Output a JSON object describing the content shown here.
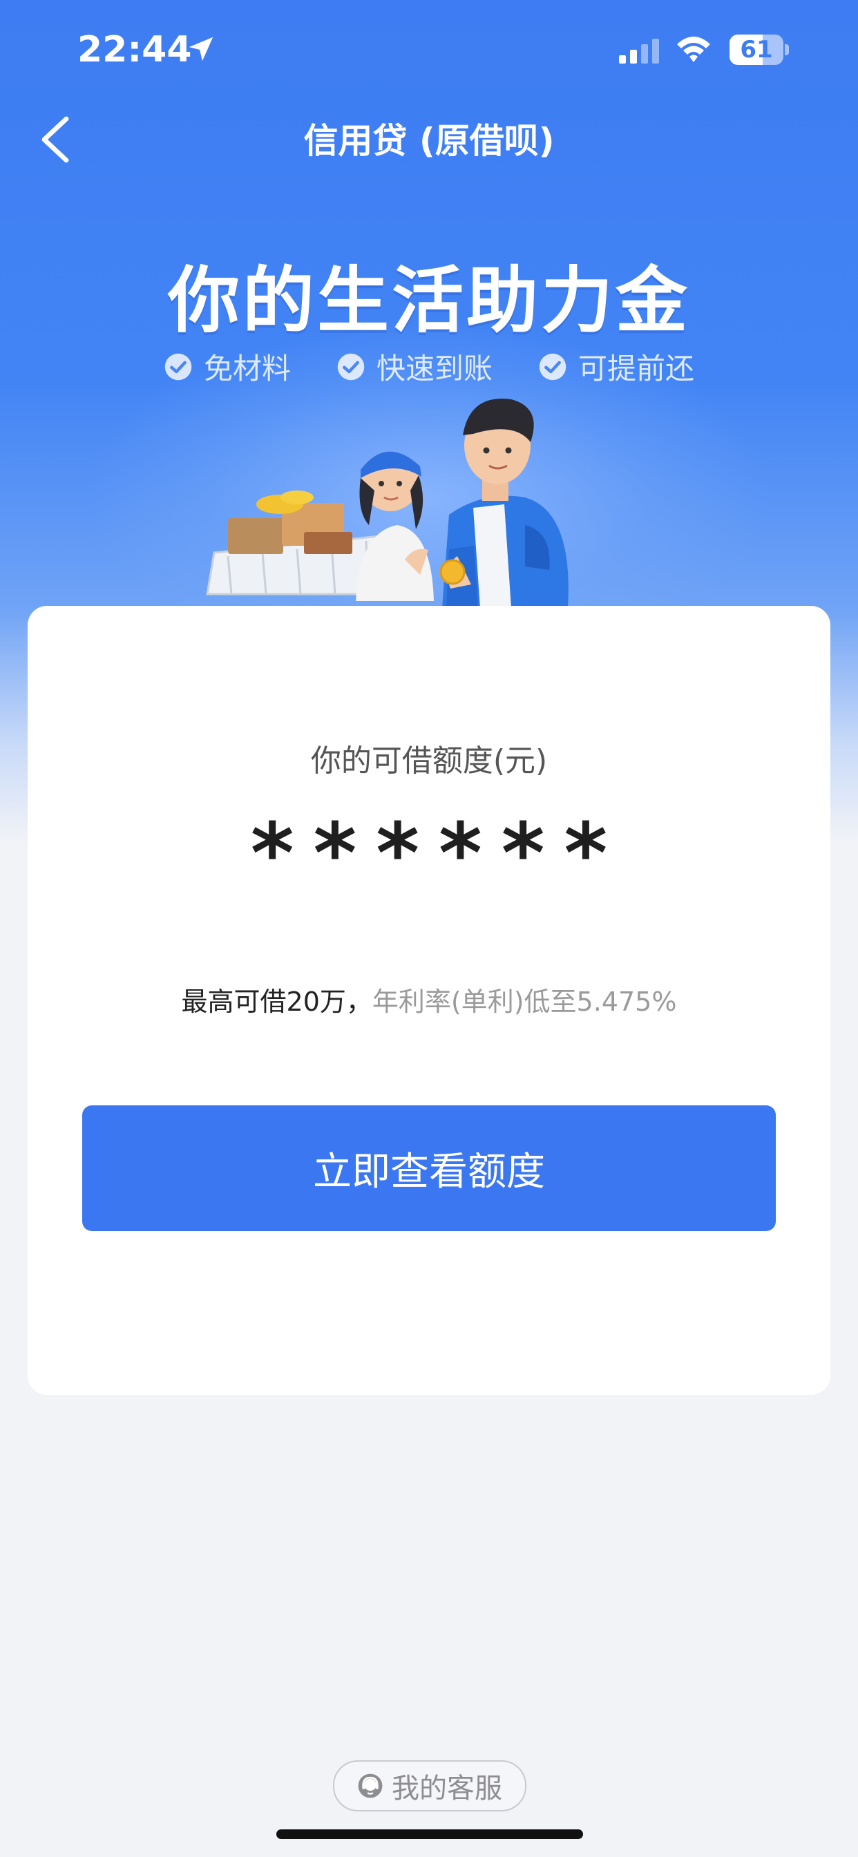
{
  "status_bar": {
    "time": "22:44",
    "battery_level": "61",
    "battery_fraction": 0.61,
    "icons": [
      "location-arrow-icon",
      "signal-icon",
      "wifi-icon",
      "battery-icon"
    ]
  },
  "nav": {
    "back_icon": "chevron-left-icon",
    "title": "信用贷 (原借呗)"
  },
  "hero": {
    "title": "你的生活助力金",
    "features": [
      "免材料",
      "快速到账",
      "可提前还"
    ],
    "feature_icon": "check-circle-icon"
  },
  "card": {
    "limit_label": "你的可借额度(元)",
    "masked_amount": [
      "*",
      "*",
      "*",
      "*",
      "*",
      "*"
    ],
    "info_main": "最高可借20万，",
    "info_sub": "年利率(单利)低至5.475%",
    "cta_label": "立即查看额度"
  },
  "footer": {
    "service_label": "我的客服",
    "service_icon": "customer-service-icon"
  },
  "colors": {
    "primary": "#3a77f0",
    "header_bg": "#3d7cf2",
    "page_bg": "#f2f3f7"
  }
}
